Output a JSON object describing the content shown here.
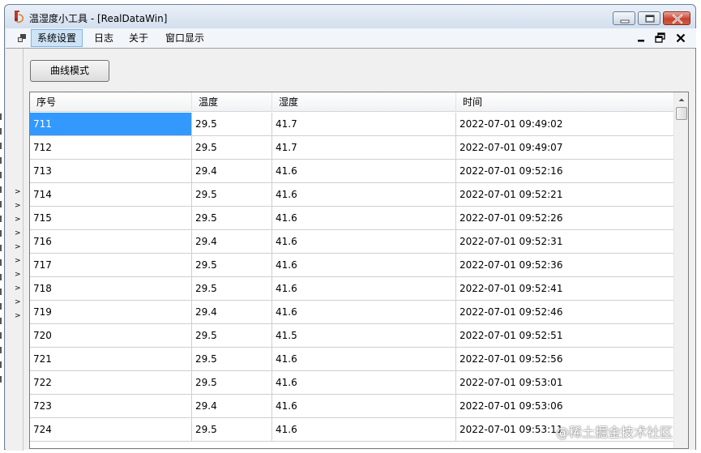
{
  "window": {
    "title": "温湿度小工具 - [RealDataWin]",
    "accent": "#3399ff"
  },
  "menu": {
    "items": [
      {
        "label": "系统设置"
      },
      {
        "label": "日志"
      },
      {
        "label": "关于"
      },
      {
        "label": "窗口显示"
      }
    ]
  },
  "toolbar": {
    "curve_button_label": "曲线模式"
  },
  "table": {
    "columns": [
      "序号",
      "温度",
      "湿度",
      "时间"
    ],
    "rows": [
      [
        "711",
        "29.5",
        "41.7",
        "2022-07-01 09:49:02"
      ],
      [
        "712",
        "29.5",
        "41.7",
        "2022-07-01 09:49:07"
      ],
      [
        "713",
        "29.4",
        "41.6",
        "2022-07-01 09:52:16"
      ],
      [
        "714",
        "29.5",
        "41.6",
        "2022-07-01 09:52:21"
      ],
      [
        "715",
        "29.5",
        "41.6",
        "2022-07-01 09:52:26"
      ],
      [
        "716",
        "29.4",
        "41.6",
        "2022-07-01 09:52:31"
      ],
      [
        "717",
        "29.5",
        "41.6",
        "2022-07-01 09:52:36"
      ],
      [
        "718",
        "29.5",
        "41.6",
        "2022-07-01 09:52:41"
      ],
      [
        "719",
        "29.4",
        "41.6",
        "2022-07-01 09:52:46"
      ],
      [
        "720",
        "29.5",
        "41.5",
        "2022-07-01 09:52:51"
      ],
      [
        "721",
        "29.5",
        "41.6",
        "2022-07-01 09:52:56"
      ],
      [
        "722",
        "29.5",
        "41.6",
        "2022-07-01 09:53:01"
      ],
      [
        "723",
        "29.4",
        "41.6",
        "2022-07-01 09:53:06"
      ],
      [
        "724",
        "29.5",
        "41.6",
        "2022-07-01 09:53:11"
      ]
    ]
  },
  "watermark": "@稀土掘金技术社区"
}
